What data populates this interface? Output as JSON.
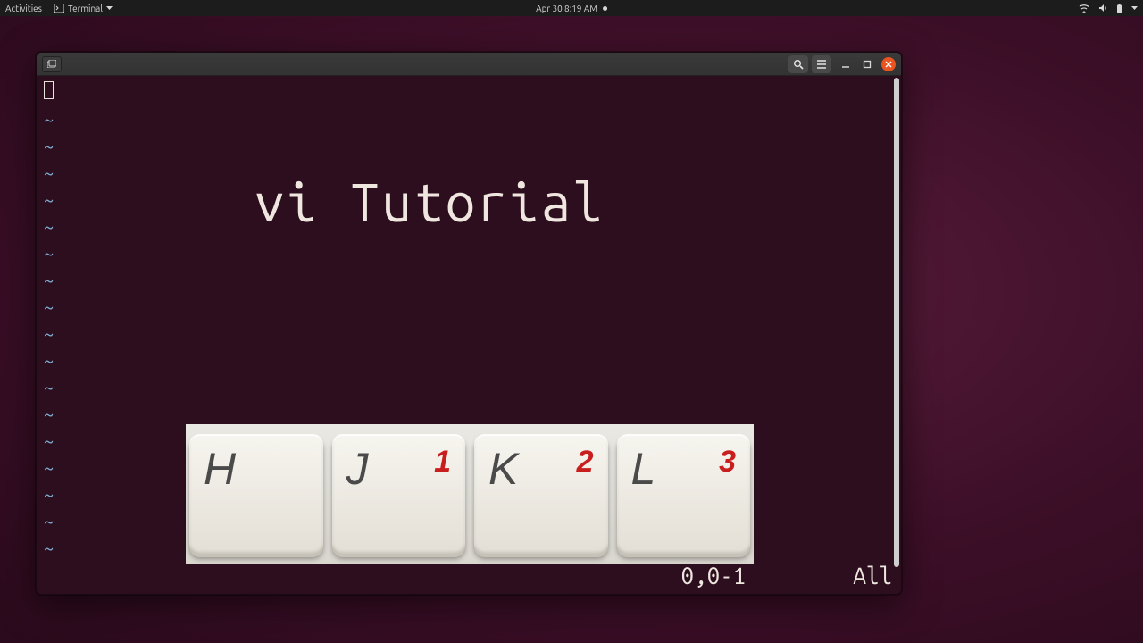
{
  "topbar": {
    "activities": "Activities",
    "app_name": "Terminal",
    "datetime": "Apr 30  8:19 AM"
  },
  "overlay": {
    "title": "vi Tutorial"
  },
  "editor": {
    "tilde": "~",
    "position": "0,0-1",
    "view": "All"
  },
  "keys": [
    {
      "letter": "H",
      "num": ""
    },
    {
      "letter": "J",
      "num": "1"
    },
    {
      "letter": "K",
      "num": "2"
    },
    {
      "letter": "L",
      "num": "3"
    }
  ]
}
